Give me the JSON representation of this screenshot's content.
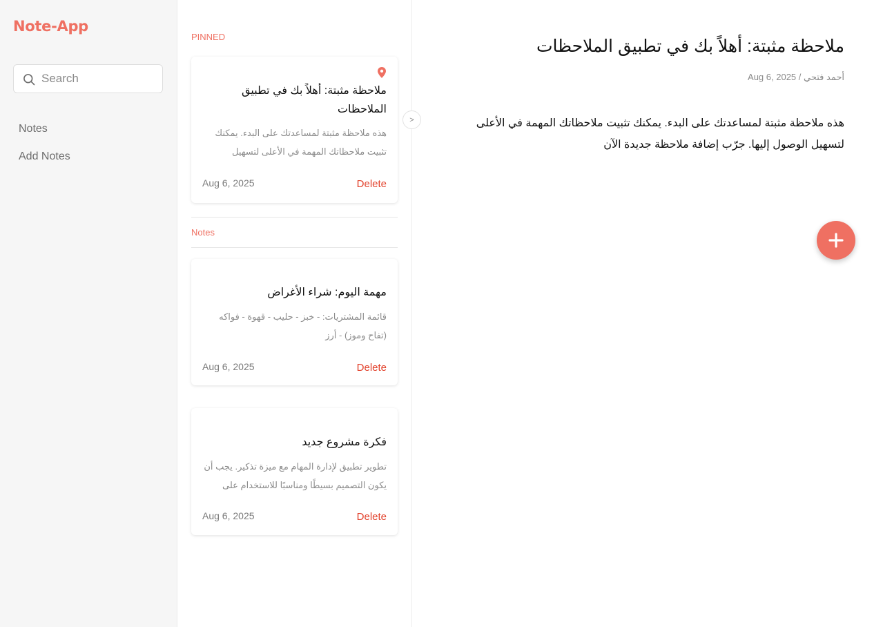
{
  "app": {
    "title": "Note-App"
  },
  "sidebar": {
    "search": {
      "placeholder": "Search",
      "value": ""
    },
    "nav": [
      {
        "label": "Notes"
      },
      {
        "label": "Add Notes"
      }
    ]
  },
  "list": {
    "pinned_label": "PINNED",
    "notes_label": "Notes",
    "delete_label": "Delete",
    "pinned": [
      {
        "title": "ملاحظة مثبتة: أهلاً بك في تطبيق الملاحظات",
        "excerpt": "هذه ملاحظة مثبتة لمساعدتك على البدء. يمكنك تثبيت ملاحظاتك المهمة في الأعلى لتسهيل",
        "date": "Aug 6, 2025"
      }
    ],
    "notes": [
      {
        "title": "مهمة اليوم: شراء الأغراض",
        "excerpt": "قائمة المشتريات: - خبز - حليب - قهوة - فواكه (تفاح وموز) - أرز",
        "date": "Aug 6, 2025"
      },
      {
        "title": "فكرة مشروع جديد",
        "excerpt": "تطوير تطبيق لإدارة المهام مع ميزة تذكير. يجب أن يكون التصميم بسيطًا ومناسبًا للاستخدام على",
        "date": "Aug 6, 2025"
      }
    ]
  },
  "toggle": {
    "label": ">"
  },
  "detail": {
    "title": "ملاحظة مثبتة: أهلاً بك في تطبيق الملاحظات",
    "author": "أحمد فتحي",
    "separator": "/",
    "date": "Aug 6, 2025",
    "body": "هذه ملاحظة مثبتة لمساعدتك على البدء. يمكنك تثبيت ملاحظاتك المهمة في الأعلى لتسهيل الوصول إليها. جرّب إضافة ملاحظة جديدة الآن"
  },
  "colors": {
    "accent": "#ef7062",
    "delete": "#e2412b",
    "sidebar_bg": "#f6f6f6"
  },
  "icons": {
    "search": "search-icon",
    "pin": "pin-icon",
    "add": "plus-icon"
  }
}
